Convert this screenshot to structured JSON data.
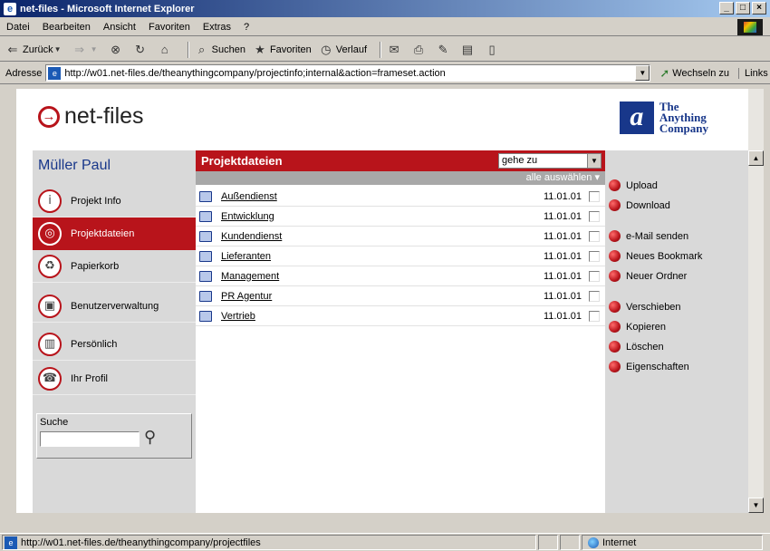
{
  "window": {
    "title": "net-files - Microsoft Internet Explorer",
    "ctrl_min": "_",
    "ctrl_max": "□",
    "ctrl_close": "×"
  },
  "menu": [
    "Datei",
    "Bearbeiten",
    "Ansicht",
    "Favoriten",
    "Extras",
    "?"
  ],
  "toolbar": {
    "back": "Zurück",
    "search": "Suchen",
    "favorites": "Favoriten",
    "history": "Verlauf"
  },
  "address": {
    "label": "Adresse",
    "url": "http://w01.net-files.de/theanythingcompany/projectinfo;internal&action=frameset.action",
    "go": "Wechseln zu",
    "links": "Links"
  },
  "header": {
    "brand": "net-files",
    "company_line1": "The",
    "company_line2": "Anything",
    "company_line3": "Company"
  },
  "user": "Müller Paul",
  "nav": [
    {
      "label": "Projekt Info",
      "icon": "info-icon"
    },
    {
      "label": "Projektdateien",
      "icon": "disk-icon",
      "active": true
    },
    {
      "label": "Papierkorb",
      "icon": "trash-icon"
    },
    {
      "label": "Benutzerverwaltung",
      "icon": "users-icon"
    },
    {
      "label": "Persönlich",
      "icon": "cabinet-icon"
    },
    {
      "label": "Ihr Profil",
      "icon": "profile-icon"
    }
  ],
  "search": {
    "label": "Suche"
  },
  "files": {
    "title": "Projektdateien",
    "goto": "gehe zu",
    "select_all": "alle auswählen",
    "rows": [
      {
        "name": "Außendienst",
        "date": "11.01.01"
      },
      {
        "name": "Entwicklung",
        "date": "11.01.01"
      },
      {
        "name": "Kundendienst",
        "date": "11.01.01"
      },
      {
        "name": "Lieferanten",
        "date": "11.01.01"
      },
      {
        "name": "Management",
        "date": "11.01.01"
      },
      {
        "name": "PR Agentur",
        "date": "11.01.01"
      },
      {
        "name": "Vertrieb",
        "date": "11.01.01"
      }
    ]
  },
  "actions": [
    "Upload",
    "Download",
    "e-Mail senden",
    "Neues Bookmark",
    "Neuer Ordner",
    "Verschieben",
    "Kopieren",
    "Löschen",
    "Eigenschaften"
  ],
  "status": {
    "url": "http://w01.net-files.de/theanythingcompany/projectfiles",
    "zone": "Internet"
  }
}
